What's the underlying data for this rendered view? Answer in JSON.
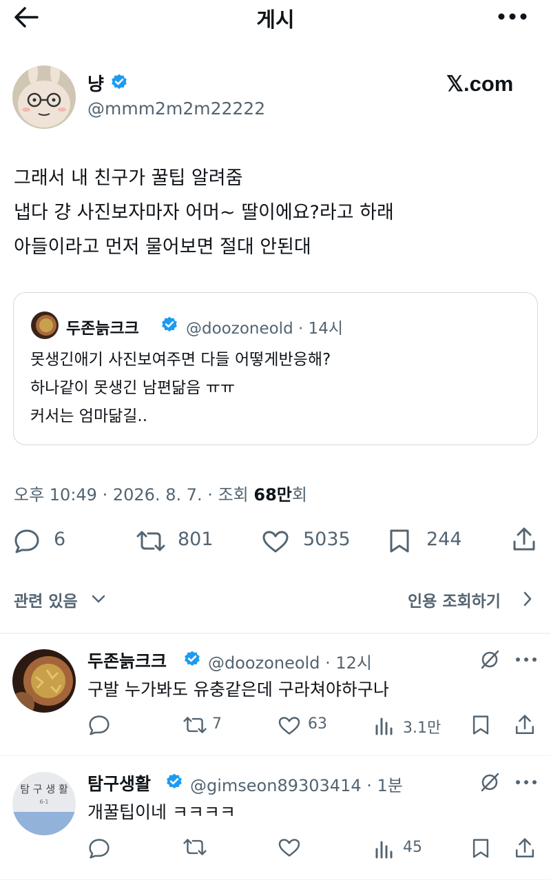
{
  "header": {
    "title": "게시",
    "back_icon": "arrow-left-icon",
    "more_icon": "more-icon"
  },
  "post": {
    "author_name": "냥",
    "author_handle": "@mmm2m2m22222",
    "watermark": "𝕏.com",
    "lines": [
      "그래서 내 친구가 꿀팁 알려줌",
      "냅다 걍 사진보자마자 어머~ 딸이에요?라고 하래",
      "아들이라고 먼저 물어보면 절대 안된대"
    ],
    "quote": {
      "author_name": "두존늙크크",
      "author_handle": "@doozoneold",
      "time": "14시",
      "lines": [
        "못생긴애기 사진보여주면 다들 어떻게반응해?",
        "하나같이 못생긴 남편닮음 ㅠㅠ",
        "커서는 엄마닮길.."
      ]
    },
    "meta": {
      "time": "오후 10:49",
      "date": "2026. 8. 7.",
      "views_label": "조회",
      "views_count": "68만",
      "views_suffix": "회"
    },
    "stats": {
      "replies": "6",
      "reposts": "801",
      "likes": "5035",
      "bookmarks": "244"
    }
  },
  "related": {
    "label": "관련 있음",
    "quote_views": "인용 조회하기"
  },
  "replies": [
    {
      "author_name": "두존늙크크",
      "author_handle": "@doozoneold",
      "time": "12시",
      "text": "구발 누가봐도 유충같은데 구라쳐야하구나",
      "stats": {
        "replies": "",
        "reposts": "7",
        "likes": "63",
        "views": "3.1만"
      }
    },
    {
      "author_name": "탐구생활",
      "author_handle": "@gimseon89303414",
      "time": "1분",
      "text": "개꿀팁이네 ㅋㅋㅋㅋ",
      "avatar_text": "탐 구  생 활",
      "avatar_subtext": "6-1",
      "stats": {
        "replies": "",
        "reposts": "",
        "likes": "",
        "views": "45"
      }
    }
  ],
  "colors": {
    "verified": "#1d9bf0",
    "text": "#0f1419",
    "secondary": "#536471",
    "border": "#cfd9de"
  }
}
